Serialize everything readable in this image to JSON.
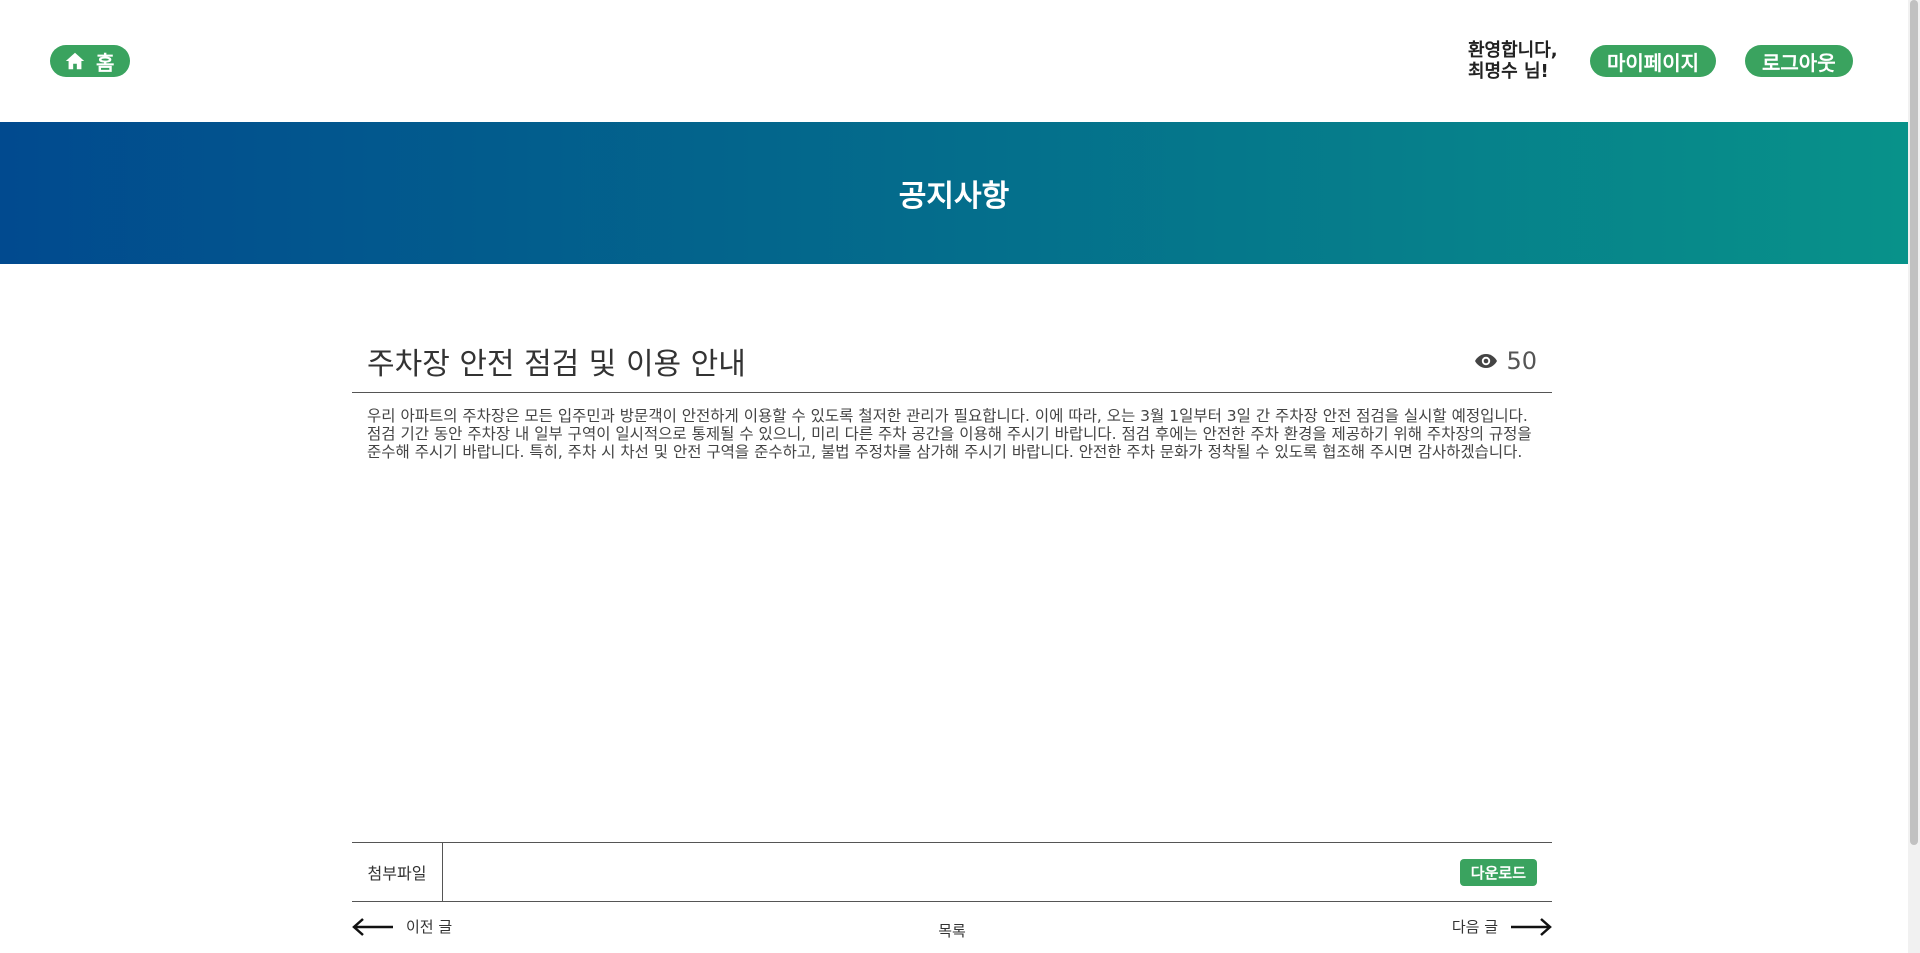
{
  "header": {
    "home_label": "홈",
    "welcome_line1": "환영합니다,",
    "welcome_line2": "최명수 님!",
    "mypage_label": "마이페이지",
    "logout_label": "로그아웃"
  },
  "banner": {
    "title": "공지사항"
  },
  "article": {
    "title": "주차장 안전 점검 및 이용 안내",
    "views": "50",
    "content": "우리 아파트의 주차장은 모든 입주민과 방문객이 안전하게 이용할 수 있도록 철저한 관리가 필요합니다. 이에 따라, 오는 3월 1일부터 3일 간 주차장 안전 점검을 실시할 예정입니다. 점검 기간 동안 주차장 내 일부 구역이 일시적으로 통제될 수 있으니, 미리 다른 주차 공간을 이용해 주시기 바랍니다. 점검 후에는 안전한 주차 환경을 제공하기 위해 주차장의 규정을 준수해 주시기 바랍니다. 특히, 주차 시 차선 및 안전 구역을 준수하고, 불법 주정차를 삼가해 주시기 바랍니다. 안전한 주차 문화가 정착될 수 있도록 협조해 주시면 감사하겠습니다."
  },
  "attachment": {
    "label": "첨부파일",
    "download_label": "다운로드"
  },
  "navigation": {
    "prev_label": "이전 글",
    "list_label": "목록",
    "next_label": "다음 글"
  },
  "colors": {
    "accent_green": "#3aa35f",
    "banner_start": "#014a8f",
    "banner_end": "#08928a"
  },
  "icons": {
    "home": "home-icon",
    "views": "eye-icon",
    "prev": "arrow-left-icon",
    "next": "arrow-right-icon"
  }
}
